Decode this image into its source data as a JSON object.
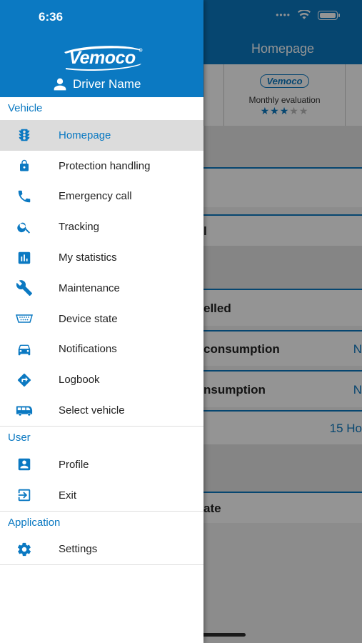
{
  "status_bar": {
    "time": "6:36"
  },
  "background": {
    "title": "Homepage",
    "card_monthly_label": "Monthly evaluation",
    "card_logo": "Vemoco",
    "stars": [
      "★",
      "★",
      "★",
      "★",
      "★"
    ],
    "rows": [
      {
        "text": "elled"
      },
      {
        "text": "consumption",
        "value": "N"
      },
      {
        "text": "nsumption",
        "value": "N"
      },
      {
        "text": "",
        "value": "15 Ho"
      },
      {
        "text": "ate"
      }
    ],
    "partial_rows": [
      "",
      "l"
    ]
  },
  "drawer": {
    "brand": "Vemoco",
    "driver_name": "Driver Name",
    "sections": {
      "vehicle": "Vehicle",
      "user": "User",
      "application": "Application"
    },
    "vehicle_items": [
      {
        "label": "Homepage",
        "icon": "traffic-light-icon"
      },
      {
        "label": "Protection handling",
        "icon": "lock-icon"
      },
      {
        "label": "Emergency call",
        "icon": "phone-icon"
      },
      {
        "label": "Tracking",
        "icon": "search-icon"
      },
      {
        "label": "My statistics",
        "icon": "bar-chart-icon"
      },
      {
        "label": "Maintenance",
        "icon": "wrench-icon"
      },
      {
        "label": "Device state",
        "icon": "obd-connector-icon"
      },
      {
        "label": "Notifications",
        "icon": "car-icon"
      },
      {
        "label": "Logbook",
        "icon": "directions-icon"
      },
      {
        "label": "Select vehicle",
        "icon": "bus-icon"
      }
    ],
    "user_items": [
      {
        "label": "Profile",
        "icon": "account-box-icon"
      },
      {
        "label": "Exit",
        "icon": "exit-icon"
      }
    ],
    "application_items": [
      {
        "label": "Settings",
        "icon": "gear-icon"
      }
    ]
  },
  "colors": {
    "brand": "#0b79c2",
    "active_row": "#dcdcdc"
  }
}
